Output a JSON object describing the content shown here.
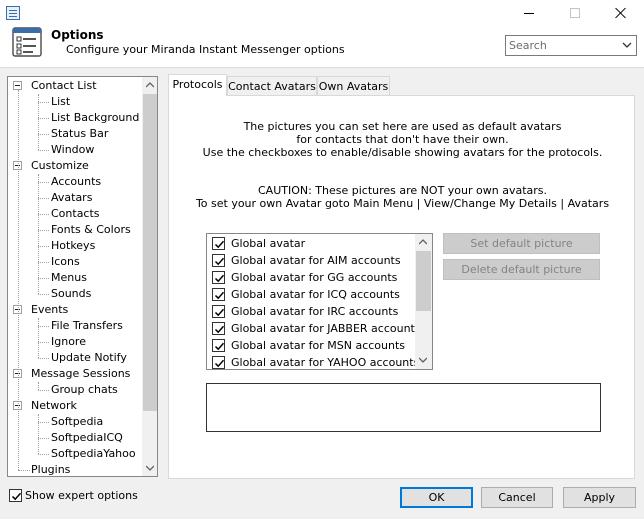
{
  "window": {
    "title": "Options",
    "subtitle": "Configure your Miranda Instant Messenger options",
    "search_placeholder": "Search"
  },
  "tree": {
    "items": [
      {
        "label": "Contact List",
        "level": 0,
        "expanded": true
      },
      {
        "label": "List",
        "level": 1
      },
      {
        "label": "List Background",
        "level": 1
      },
      {
        "label": "Status Bar",
        "level": 1
      },
      {
        "label": "Window",
        "level": 1
      },
      {
        "label": "Customize",
        "level": 0,
        "expanded": true
      },
      {
        "label": "Accounts",
        "level": 1
      },
      {
        "label": "Avatars",
        "level": 1,
        "selected": true
      },
      {
        "label": "Contacts",
        "level": 1
      },
      {
        "label": "Fonts & Colors",
        "level": 1
      },
      {
        "label": "Hotkeys",
        "level": 1
      },
      {
        "label": "Icons",
        "level": 1
      },
      {
        "label": "Menus",
        "level": 1
      },
      {
        "label": "Sounds",
        "level": 1
      },
      {
        "label": "Events",
        "level": 0,
        "expanded": true
      },
      {
        "label": "File Transfers",
        "level": 1
      },
      {
        "label": "Ignore",
        "level": 1
      },
      {
        "label": "Update Notify",
        "level": 1
      },
      {
        "label": "Message Sessions",
        "level": 0,
        "expanded": true
      },
      {
        "label": "Group chats",
        "level": 1
      },
      {
        "label": "Network",
        "level": 0,
        "expanded": true
      },
      {
        "label": "Softpedia",
        "level": 1
      },
      {
        "label": "SoftpediaICQ",
        "level": 1
      },
      {
        "label": "SoftpediaYahoo",
        "level": 1
      },
      {
        "label": "Plugins",
        "level": 0
      }
    ]
  },
  "tabs": [
    {
      "label": "Protocols",
      "active": true
    },
    {
      "label": "Contact Avatars",
      "active": false
    },
    {
      "label": "Own Avatars",
      "active": false
    }
  ],
  "panel": {
    "info_lines": [
      "The pictures you can set here are used as default avatars",
      "for contacts that don't have their own.",
      "Use the checkboxes to enable/disable showing avatars for the protocols."
    ],
    "caution_lines": [
      "CAUTION: These pictures are NOT your own avatars.",
      "To set your own Avatar goto Main Menu | View/Change My Details | Avatars"
    ],
    "protocols": [
      {
        "label": "Global avatar",
        "checked": true
      },
      {
        "label": "Global avatar for AIM accounts",
        "checked": true
      },
      {
        "label": "Global avatar for GG accounts",
        "checked": true
      },
      {
        "label": "Global avatar for ICQ accounts",
        "checked": true
      },
      {
        "label": "Global avatar for IRC accounts",
        "checked": true
      },
      {
        "label": "Global avatar for JABBER accounts",
        "checked": true
      },
      {
        "label": "Global avatar for MSN accounts",
        "checked": true
      },
      {
        "label": "Global avatar for YAHOO accounts",
        "checked": true
      }
    ],
    "set_default_label": "Set default picture",
    "delete_default_label": "Delete default picture"
  },
  "footer": {
    "expert_label": "Show expert options",
    "expert_checked": true,
    "ok_label": "OK",
    "cancel_label": "Cancel",
    "apply_label": "Apply"
  },
  "colors": {
    "accent": "#0078d7",
    "disabled_button": "#cccccc"
  }
}
